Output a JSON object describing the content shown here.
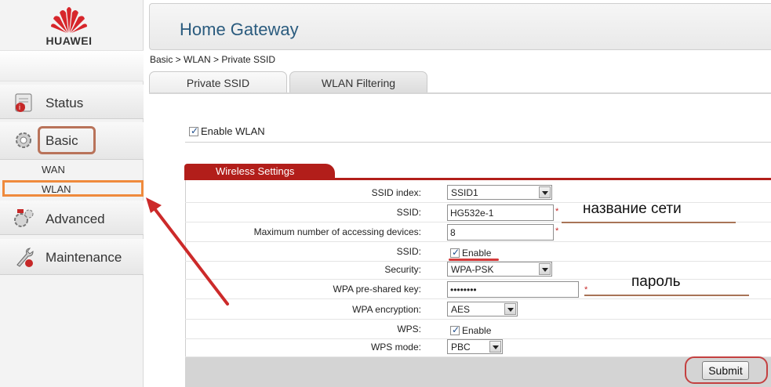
{
  "brand": {
    "logo_text": "HUAWEI"
  },
  "header": {
    "title": "Home Gateway"
  },
  "breadcrumb": "Basic > WLAN > Private SSID",
  "sidebar": {
    "items": [
      {
        "label": "Status",
        "icon": "status-icon"
      },
      {
        "label": "Basic",
        "icon": "gear-icon"
      },
      {
        "label": "Advanced",
        "icon": "advanced-icon"
      },
      {
        "label": "Maintenance",
        "icon": "wrench-icon"
      }
    ],
    "sub_items": [
      "WAN",
      "WLAN"
    ]
  },
  "tabs": [
    {
      "label": "Private SSID"
    },
    {
      "label": "WLAN Filtering"
    }
  ],
  "enable_wlan": {
    "label": "Enable WLAN",
    "checked": true
  },
  "wireless": {
    "section_title": "Wireless Settings",
    "ssid_index": {
      "label": "SSID index:",
      "value": "SSID1"
    },
    "ssid": {
      "label": "SSID:",
      "value": "HG532e-1"
    },
    "max_devices": {
      "label": "Maximum number of accessing devices:",
      "value": "8"
    },
    "ssid_enable": {
      "label": "SSID:",
      "text": "Enable",
      "checked": true
    },
    "security": {
      "label": "Security:",
      "value": "WPA-PSK"
    },
    "psk": {
      "label": "WPA pre-shared key:",
      "value": "••••••••"
    },
    "encryption": {
      "label": "WPA encryption:",
      "value": "AES"
    },
    "wps": {
      "label": "WPS:",
      "text": "Enable",
      "checked": true
    },
    "wps_mode": {
      "label": "WPS mode:",
      "value": "PBC"
    },
    "required_mark": "*"
  },
  "annotations": {
    "network_name": "название сети",
    "password": "пароль"
  },
  "submit_label": "Submit",
  "colors": {
    "accent": "#b21e1a",
    "highlight_orange": "#ef8a3c",
    "highlight_red": "#c44040",
    "title_blue": "#2a5b7e"
  }
}
